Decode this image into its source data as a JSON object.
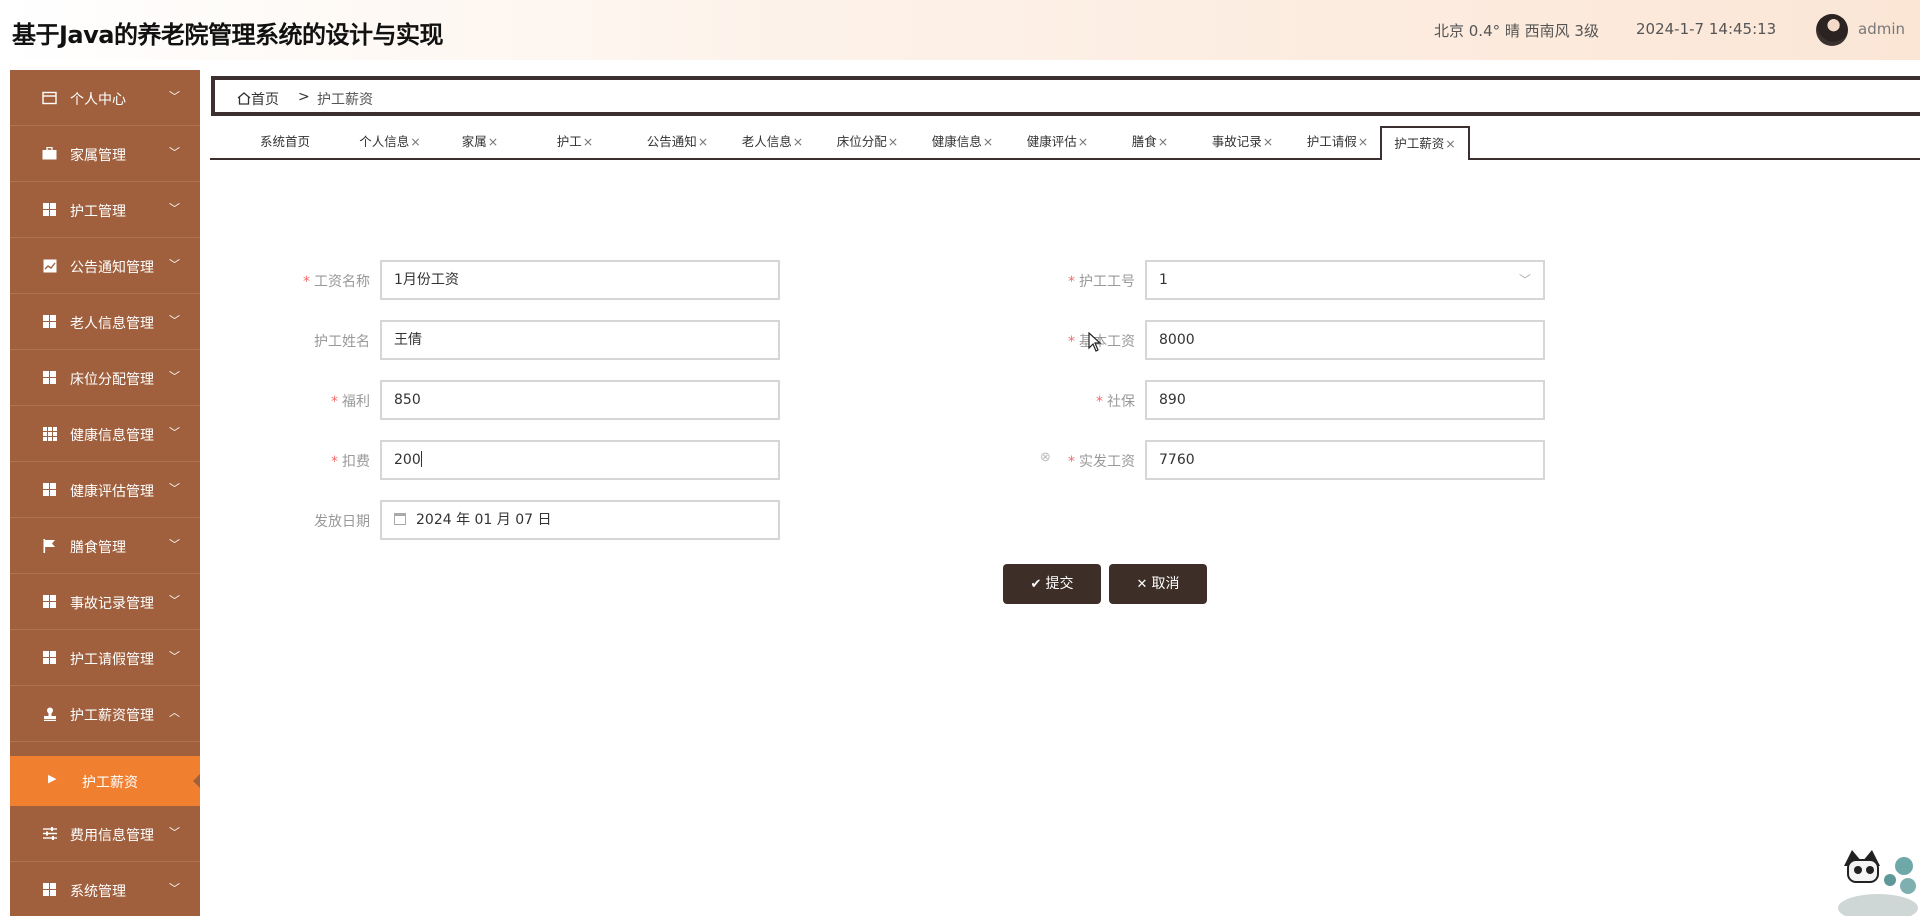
{
  "header": {
    "title": "基于Java的养老院管理系统的设计与实现",
    "weather": "北京  0.4°  晴  西南风  3级",
    "datetime": "2024-1-7 14:45:13",
    "username": "admin"
  },
  "sidebar": {
    "items": [
      {
        "label": "个人中心",
        "icon": "calendar-icon"
      },
      {
        "label": "家属管理",
        "icon": "briefcase-icon"
      },
      {
        "label": "护工管理",
        "icon": "grid-icon"
      },
      {
        "label": "公告通知管理",
        "icon": "chart-icon"
      },
      {
        "label": "老人信息管理",
        "icon": "grid-icon"
      },
      {
        "label": "床位分配管理",
        "icon": "grid-icon"
      },
      {
        "label": "健康信息管理",
        "icon": "grid9-icon"
      },
      {
        "label": "健康评估管理",
        "icon": "grid-icon"
      },
      {
        "label": "膳食管理",
        "icon": "flag-icon"
      },
      {
        "label": "事故记录管理",
        "icon": "grid-icon"
      },
      {
        "label": "护工请假管理",
        "icon": "grid-icon"
      },
      {
        "label": "护工薪资管理",
        "icon": "stamp-icon"
      },
      {
        "label": "费用信息管理",
        "icon": "sliders-icon"
      },
      {
        "label": "系统管理",
        "icon": "grid-icon"
      }
    ],
    "active_sub": "护工薪资"
  },
  "breadcrumb": {
    "home": "首页",
    "separator": ">",
    "current": "护工薪资"
  },
  "tabs": [
    {
      "label": "系统首页",
      "closable": false
    },
    {
      "label": "个人信息",
      "closable": true
    },
    {
      "label": "家属",
      "closable": true
    },
    {
      "label": "护工",
      "closable": true
    },
    {
      "label": "公告通知",
      "closable": true
    },
    {
      "label": "老人信息",
      "closable": true
    },
    {
      "label": "床位分配",
      "closable": true
    },
    {
      "label": "健康信息",
      "closable": true
    },
    {
      "label": "健康评估",
      "closable": true
    },
    {
      "label": "膳食",
      "closable": true
    },
    {
      "label": "事故记录",
      "closable": true
    },
    {
      "label": "护工请假",
      "closable": true
    },
    {
      "label": "护工薪资",
      "closable": true,
      "active": true
    }
  ],
  "tab_close_glyph": "×",
  "form": {
    "salary_name": {
      "label": "工资名称",
      "required": true,
      "value": "1月份工资"
    },
    "nurse_id": {
      "label": "护工工号",
      "required": true,
      "value": "1"
    },
    "nurse_name": {
      "label": "护工姓名",
      "required": false,
      "value": "王倩"
    },
    "base_salary": {
      "label": "基本工资",
      "required": true,
      "value": "8000"
    },
    "welfare": {
      "label": "福利",
      "required": true,
      "value": "850"
    },
    "social_security": {
      "label": "社保",
      "required": true,
      "value": "890"
    },
    "deduction": {
      "label": "扣费",
      "required": true,
      "value": "200"
    },
    "net_salary": {
      "label": "实发工资",
      "required": true,
      "value": "7760"
    },
    "pay_date": {
      "label": "发放日期",
      "required": false,
      "value": "2024 年 01 月 07 日"
    }
  },
  "buttons": {
    "submit": "提交",
    "cancel": "取消"
  },
  "colors": {
    "sidebar_bg": "#a0603d",
    "active_sub_bg": "#f07f30",
    "button_bg": "#3d2e28",
    "required": "#f56c6c"
  }
}
